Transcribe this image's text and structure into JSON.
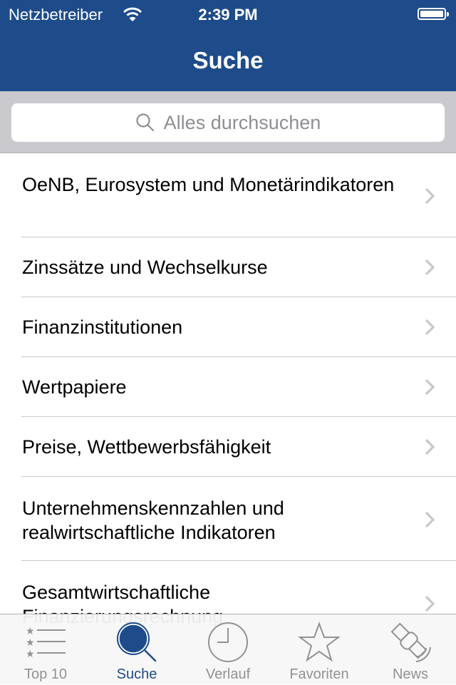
{
  "status_bar": {
    "carrier": "Netzbetreiber",
    "time": "2:39 PM",
    "wifi_icon": "wifi-icon",
    "battery_icon": "battery-full-icon"
  },
  "nav": {
    "title": "Suche"
  },
  "search": {
    "placeholder": "Alles durchsuchen",
    "icon": "search-icon"
  },
  "categories": [
    {
      "label": "OeNB, Eurosystem und Monetärindikatoren"
    },
    {
      "label": "Zinssätze und Wechselkurse"
    },
    {
      "label": "Finanzinstitutionen"
    },
    {
      "label": "Wertpapiere"
    },
    {
      "label": "Preise, Wettbewerbsfähigkeit"
    },
    {
      "label": "Unternehmenskennzahlen und realwirtschaftliche Indikatoren"
    },
    {
      "label": "Gesamtwirtschaftliche Finanzierungsrechnung"
    }
  ],
  "tabbar": {
    "tabs": [
      {
        "label": "Top 10",
        "icon": "top10-list-icon",
        "active": false
      },
      {
        "label": "Suche",
        "icon": "search-icon",
        "active": true
      },
      {
        "label": "Verlauf",
        "icon": "clock-icon",
        "active": false
      },
      {
        "label": "Favoriten",
        "icon": "star-icon",
        "active": false
      },
      {
        "label": "News",
        "icon": "satellite-icon",
        "active": false
      }
    ]
  },
  "colors": {
    "brand_blue": "#1E4C8A",
    "search_bg": "#C9C9CE",
    "separator": "#C8C7CC",
    "tab_inactive": "#929292",
    "chevron": "#C7C7CC"
  }
}
